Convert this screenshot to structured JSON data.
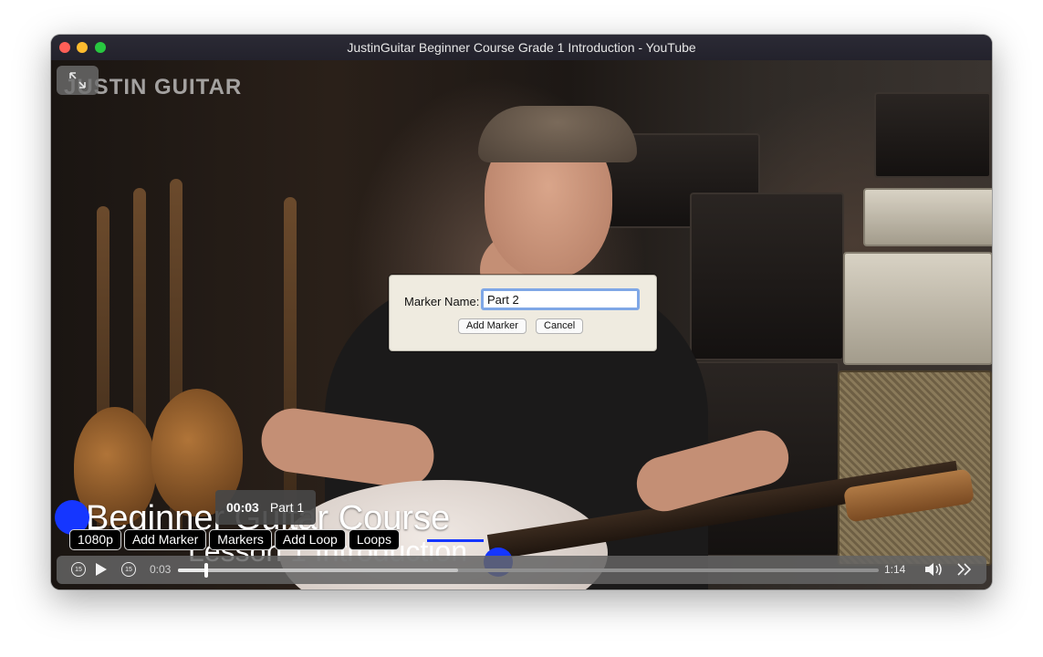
{
  "window": {
    "title": "JustinGuitar Beginner Course Grade 1 Introduction - YouTube"
  },
  "video": {
    "logo_text": "JUSTIN GUITAR",
    "overlay_title": "Beginner Guitar Course",
    "overlay_subtitle": "Lesson 1 Introduction",
    "fullscreen_icon": "arrows-expand-icon"
  },
  "marker_tooltip": {
    "time": "00:03",
    "label": "Part 1"
  },
  "toolbar": {
    "quality_label": "1080p",
    "add_marker_label": "Add Marker",
    "markers_label": "Markers",
    "add_loop_label": "Add Loop",
    "loops_label": "Loops"
  },
  "controls": {
    "skip_back_text": "15",
    "skip_forward_text": "15",
    "current_time": "0:03",
    "duration": "1:14",
    "progress_fraction": 0.04,
    "buffered_fraction": 0.4,
    "icons": [
      "skip-back-15-icon",
      "play-icon",
      "skip-forward-15-icon",
      "volume-icon",
      "forward-chevron-icon"
    ]
  },
  "dialog": {
    "label": "Marker Name:",
    "input_value": "Part 2",
    "add_button": "Add Marker",
    "cancel_button": "Cancel",
    "accent_color": "#7fa7e6"
  }
}
